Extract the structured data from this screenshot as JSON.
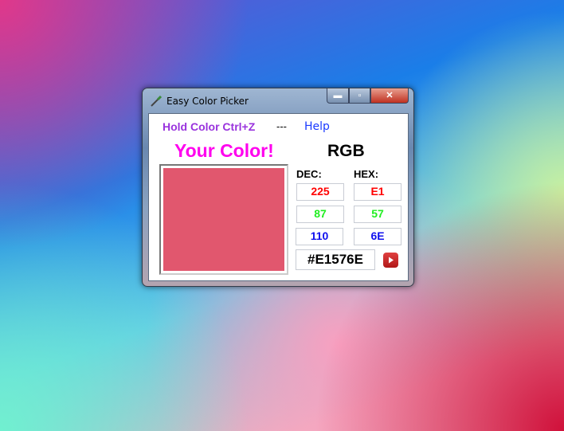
{
  "window": {
    "title": "Easy Color Picker"
  },
  "menu": {
    "hold": "Hold Color Ctrl+Z",
    "sep": "---",
    "help": "Help"
  },
  "labels": {
    "your_color": "Your Color!",
    "rgb": "RGB",
    "dec": "DEC:",
    "hex": "HEX:"
  },
  "color": {
    "swatch": "#E1576E",
    "dec": {
      "r": "225",
      "g": "87",
      "b": "110"
    },
    "hex": {
      "r": "E1",
      "g": "57",
      "b": "6E"
    },
    "hex_code": "#E1576E"
  }
}
